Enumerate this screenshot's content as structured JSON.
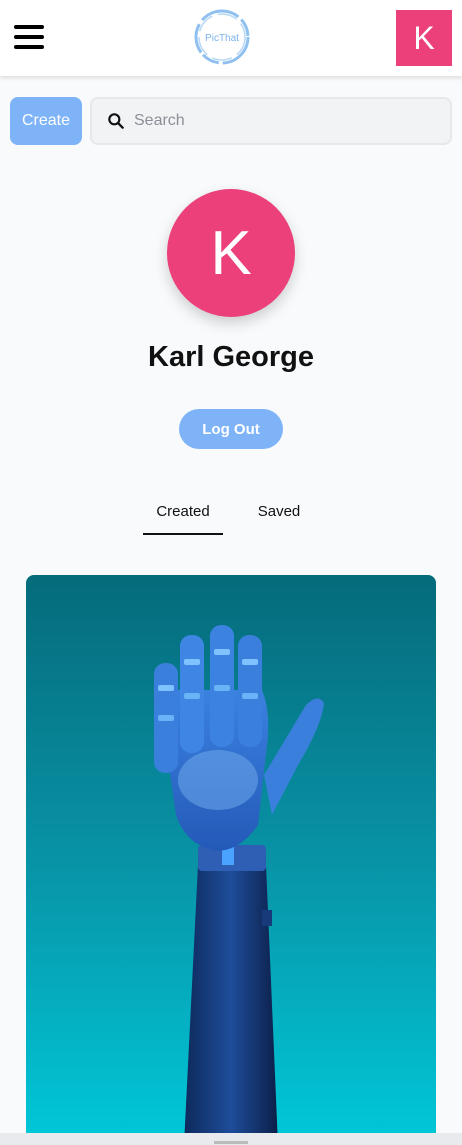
{
  "header": {
    "logo_text": "PicThat",
    "avatar_initial": "K",
    "accent_color": "#ec407a"
  },
  "toolbar": {
    "create_label": "Create",
    "search_placeholder": "Search",
    "button_color": "#7eb4f7"
  },
  "profile": {
    "avatar_initial": "K",
    "name": "Karl George",
    "logout_label": "Log Out"
  },
  "tabs": [
    {
      "label": "Created",
      "active": true
    },
    {
      "label": "Saved",
      "active": false
    }
  ],
  "pins": [
    {
      "subject": "robotic-hand-image"
    }
  ],
  "icons": [
    "hamburger-menu-icon",
    "search-icon"
  ]
}
